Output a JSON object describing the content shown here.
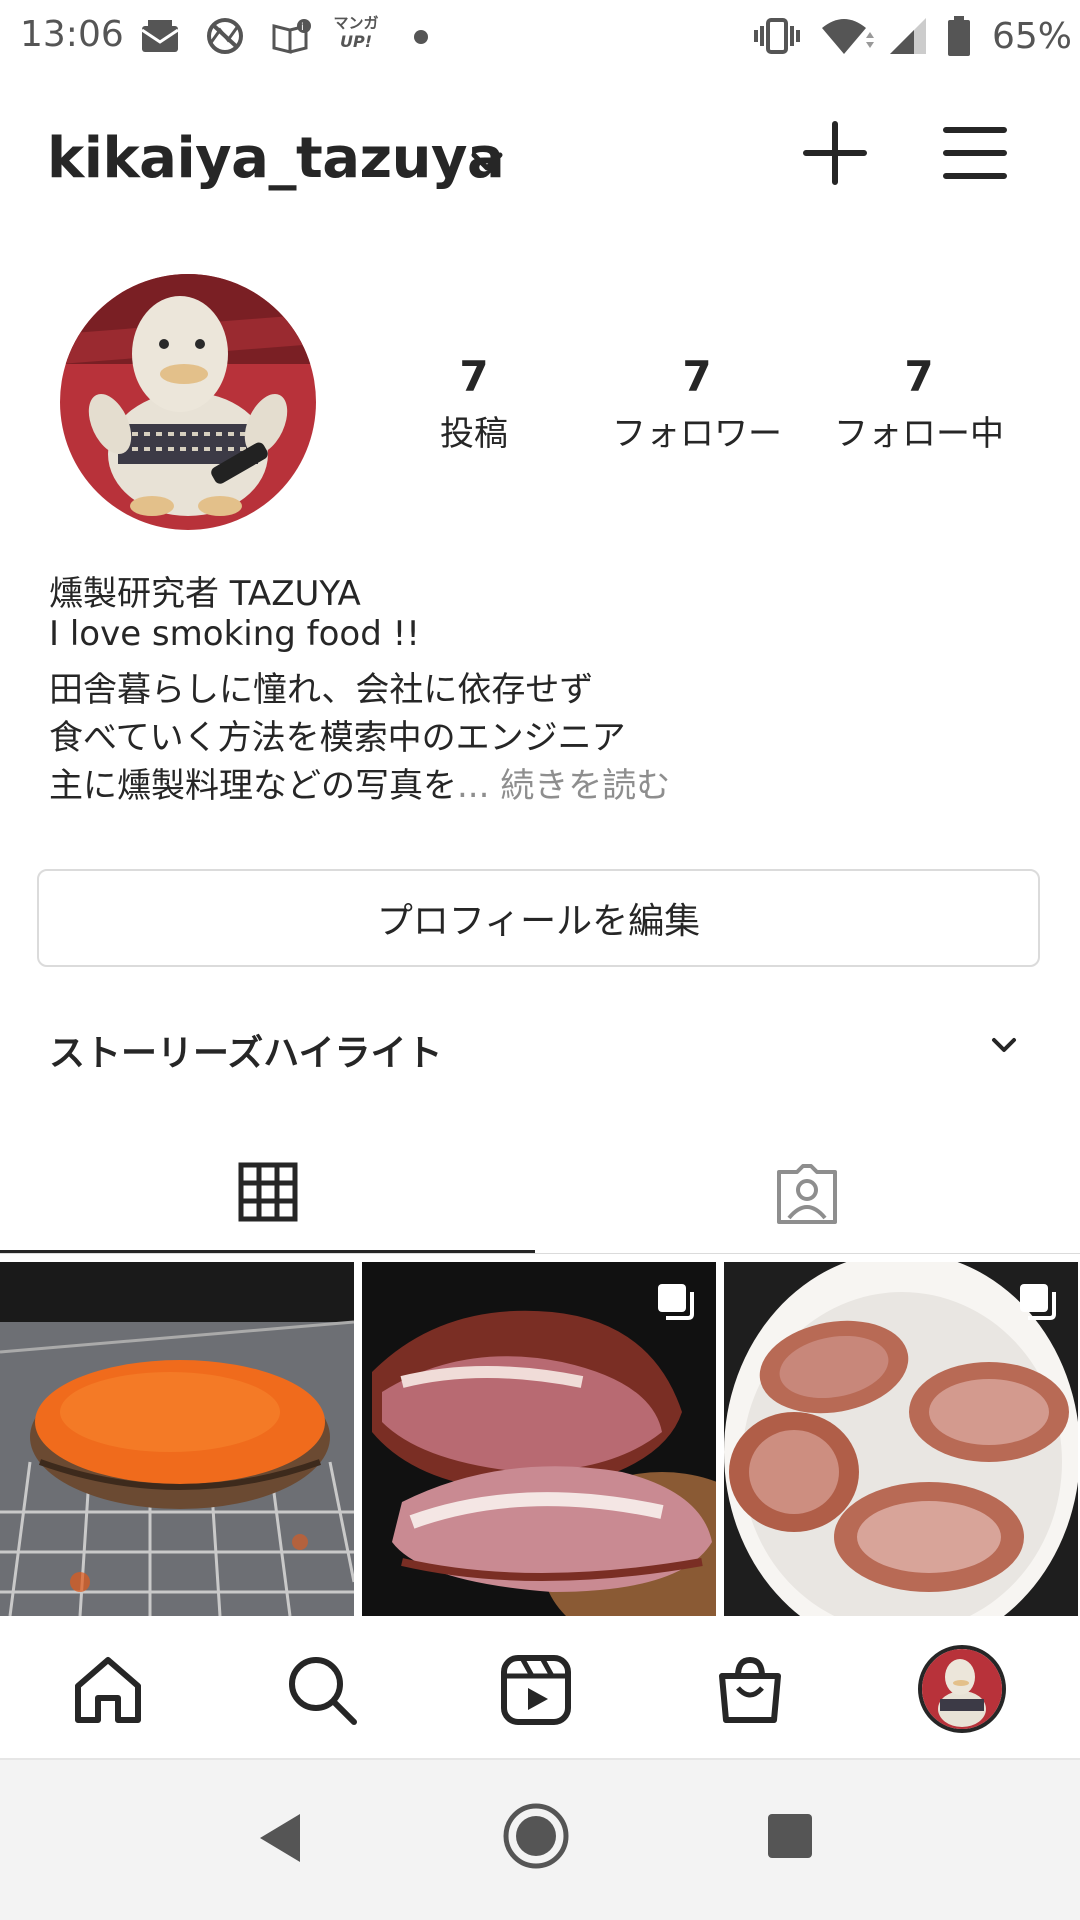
{
  "status_bar": {
    "time": "13:06",
    "notification_icons": [
      "mail-icon",
      "sync-icon",
      "news-icon",
      "manga-up-icon",
      "dot-icon"
    ],
    "manga_label_top": "マンガ",
    "manga_label_bottom": "UP!",
    "right_icons": [
      "vibrate-icon",
      "wifi-icon",
      "signal-icon",
      "battery-icon"
    ],
    "battery": "65%"
  },
  "header": {
    "username": "kikaiya_tazuya",
    "icons": [
      "chevron-down-icon",
      "plus-icon",
      "menu-icon"
    ]
  },
  "profile": {
    "stats": [
      {
        "value": "7",
        "label": "投稿"
      },
      {
        "value": "7",
        "label": "フォロワー"
      },
      {
        "value": "7",
        "label": "フォロー中"
      }
    ],
    "bio": {
      "name": "燻製研究者  TAZUYA",
      "line1": "I love smoking food !!",
      "line2": "田舎暮らしに憧れ、会社に依存せず",
      "line3": "食べていく方法を模索中のエンジニア",
      "line4": "主に燻製料理などの写真を",
      "ellipsis": "...",
      "more": "続きを読む"
    },
    "edit_button": "プロフィールを編集",
    "highlights_title": "ストーリーズハイライト"
  },
  "tabs": [
    {
      "name": "grid",
      "icon": "grid-icon",
      "active": true
    },
    {
      "name": "tagged",
      "icon": "tagged-person-icon",
      "active": false
    }
  ],
  "posts": [
    {
      "subject": "smoked roe with paprika",
      "multi": false
    },
    {
      "subject": "cured ham slices",
      "multi": true
    },
    {
      "subject": "pork steaks in bowl",
      "multi": true
    }
  ],
  "bottom_nav": [
    "home-icon",
    "search-icon",
    "reels-icon",
    "shop-icon",
    "profile-avatar"
  ],
  "android_nav": [
    "back-icon",
    "home-button-icon",
    "recents-icon"
  ],
  "colors": {
    "text": "#262626",
    "muted": "#8e8e8e",
    "border": "#dbdbdb",
    "avatar_bg": "#b8323a"
  }
}
